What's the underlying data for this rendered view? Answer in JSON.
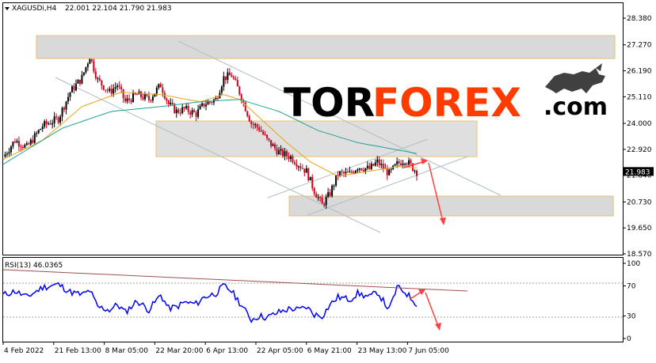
{
  "header": {
    "symbol": "XAGUSDi,H4",
    "ohlc": "22.001 22.104 21.790 21.983"
  },
  "logo": {
    "part1": "TOR",
    "part2": "FOREX",
    "part3": ".com"
  },
  "colors": {
    "bull": "#000000",
    "bear": "#d0021b",
    "ma_fast": "#e8a317",
    "ma_slow": "#20a090",
    "rsi": "#0000ff",
    "zone_fill": "#d9d9d9",
    "zone_border": "#f0c060",
    "channel": "#b0bec5",
    "arrow": "#ff4040",
    "trend": "#a05050"
  },
  "chart_data": [
    {
      "type": "candlestick",
      "ylim": [
        18.57,
        28.38
      ],
      "yticks": [
        "28.380",
        "27.270",
        "26.190",
        "25.110",
        "24.000",
        "22.920",
        "21.840",
        "20.730",
        "19.650",
        "18.570"
      ],
      "last_price": "21.983",
      "xticks": [
        "4 Feb 2022",
        "21 Feb 13:00",
        "8 Mar 05:00",
        "22 Mar 20:00",
        "6 Apr 13:00",
        "22 Apr 05:00",
        "6 May 21:00",
        "23 May 13:00",
        "7 Jun 05:00"
      ],
      "close_path": [
        [
          0,
          22.6
        ],
        [
          6,
          23.3
        ],
        [
          12,
          23.0
        ],
        [
          20,
          23.9
        ],
        [
          28,
          24.2
        ],
        [
          34,
          25.3
        ],
        [
          40,
          25.9
        ],
        [
          44,
          26.8
        ],
        [
          48,
          25.8
        ],
        [
          54,
          25.3
        ],
        [
          58,
          25.6
        ],
        [
          62,
          24.9
        ],
        [
          68,
          25.2
        ],
        [
          74,
          25.0
        ],
        [
          80,
          25.6
        ],
        [
          84,
          24.8
        ],
        [
          88,
          24.5
        ],
        [
          92,
          24.6
        ],
        [
          98,
          24.4
        ],
        [
          102,
          24.8
        ],
        [
          108,
          25.0
        ],
        [
          112,
          25.9
        ],
        [
          116,
          26.0
        ],
        [
          120,
          25.3
        ],
        [
          126,
          24.0
        ],
        [
          130,
          23.8
        ],
        [
          134,
          23.3
        ],
        [
          140,
          22.8
        ],
        [
          146,
          22.6
        ],
        [
          150,
          22.3
        ],
        [
          154,
          22.0
        ],
        [
          158,
          21.2
        ],
        [
          162,
          20.6
        ],
        [
          166,
          21.1
        ],
        [
          170,
          21.9
        ],
        [
          176,
          21.9
        ],
        [
          180,
          22.2
        ],
        [
          186,
          22.1
        ],
        [
          190,
          22.4
        ],
        [
          196,
          21.9
        ],
        [
          200,
          22.3
        ],
        [
          204,
          22.5
        ],
        [
          210,
          21.983
        ]
      ],
      "ma_fast_path": [
        [
          0,
          22.5
        ],
        [
          20,
          23.3
        ],
        [
          40,
          24.7
        ],
        [
          60,
          25.3
        ],
        [
          80,
          25.2
        ],
        [
          100,
          24.9
        ],
        [
          112,
          25.2
        ],
        [
          120,
          25.0
        ],
        [
          132,
          24.1
        ],
        [
          144,
          23.2
        ],
        [
          156,
          22.4
        ],
        [
          170,
          21.8
        ],
        [
          185,
          22.0
        ],
        [
          200,
          22.2
        ],
        [
          210,
          22.15
        ]
      ],
      "ma_slow_path": [
        [
          0,
          22.3
        ],
        [
          30,
          23.8
        ],
        [
          55,
          24.5
        ],
        [
          80,
          24.7
        ],
        [
          100,
          24.9
        ],
        [
          120,
          25.0
        ],
        [
          140,
          24.5
        ],
        [
          160,
          23.7
        ],
        [
          180,
          23.2
        ],
        [
          200,
          22.9
        ],
        [
          210,
          22.75
        ]
      ]
    },
    {
      "type": "line",
      "title": "RSI(13) 46.0365",
      "ylim": [
        0,
        100
      ],
      "yticks": [
        "100",
        "70",
        "30",
        "0"
      ],
      "path": [
        [
          0,
          58
        ],
        [
          6,
          63
        ],
        [
          12,
          55
        ],
        [
          20,
          68
        ],
        [
          28,
          72
        ],
        [
          34,
          62
        ],
        [
          40,
          58
        ],
        [
          44,
          64
        ],
        [
          48,
          42
        ],
        [
          54,
          38
        ],
        [
          58,
          45
        ],
        [
          62,
          35
        ],
        [
          68,
          50
        ],
        [
          74,
          38
        ],
        [
          80,
          58
        ],
        [
          84,
          40
        ],
        [
          88,
          42
        ],
        [
          92,
          48
        ],
        [
          98,
          46
        ],
        [
          102,
          55
        ],
        [
          108,
          60
        ],
        [
          112,
          70
        ],
        [
          116,
          63
        ],
        [
          120,
          48
        ],
        [
          126,
          25
        ],
        [
          130,
          30
        ],
        [
          134,
          28
        ],
        [
          140,
          35
        ],
        [
          146,
          40
        ],
        [
          150,
          38
        ],
        [
          154,
          42
        ],
        [
          158,
          32
        ],
        [
          162,
          30
        ],
        [
          166,
          45
        ],
        [
          170,
          55
        ],
        [
          176,
          52
        ],
        [
          180,
          60
        ],
        [
          186,
          55
        ],
        [
          190,
          62
        ],
        [
          196,
          38
        ],
        [
          200,
          68
        ],
        [
          204,
          62
        ],
        [
          210,
          46
        ]
      ]
    }
  ]
}
